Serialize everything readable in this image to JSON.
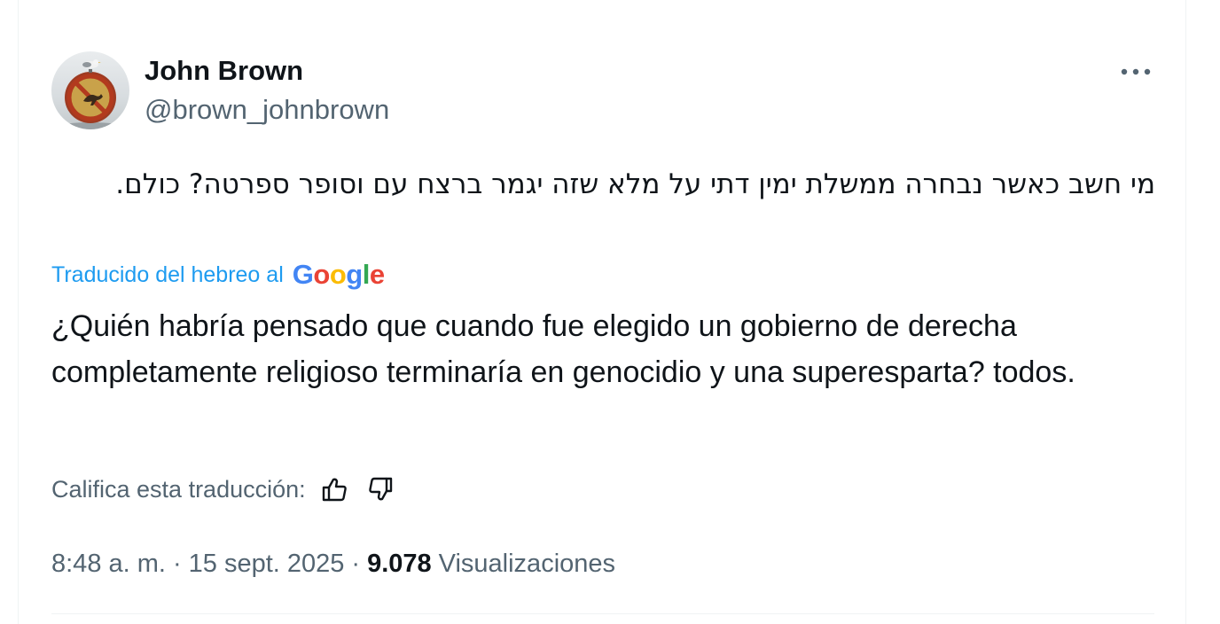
{
  "author": {
    "display_name": "John Brown",
    "handle": "@brown_johnbrown"
  },
  "post": {
    "original_text": "מי חשב כאשר נבחרה ממשלת ימין דתי על מלא שזה יגמר ברצח עם וסופר ספרטה? כולם.",
    "translated_label": "Traducido del hebreo al",
    "translator_brand": [
      "G",
      "o",
      "o",
      "g",
      "l",
      "e"
    ],
    "translation_text": "¿Quién habría pensado que cuando fue elegido un gobierno de derecha completamente religioso terminaría en genocidio y una superesparta? todos.",
    "rate_label": "Califica esta traducción:",
    "time": "8:48 a. m.",
    "date": "15 sept. 2025",
    "views_count": "9.078",
    "views_label": "Visualizaciones",
    "separator": "·"
  },
  "icons": {
    "more": "more-horizontal-icon",
    "thumbs_up": "thumbs-up-icon",
    "thumbs_down": "thumbs-down-icon"
  },
  "colors": {
    "link": "#1d9bf0",
    "secondary_text": "#536471",
    "primary_text": "#0f1419",
    "google_blue": "#4285f4",
    "google_red": "#ea4335",
    "google_yellow": "#fbbc05",
    "google_green": "#34a853"
  }
}
